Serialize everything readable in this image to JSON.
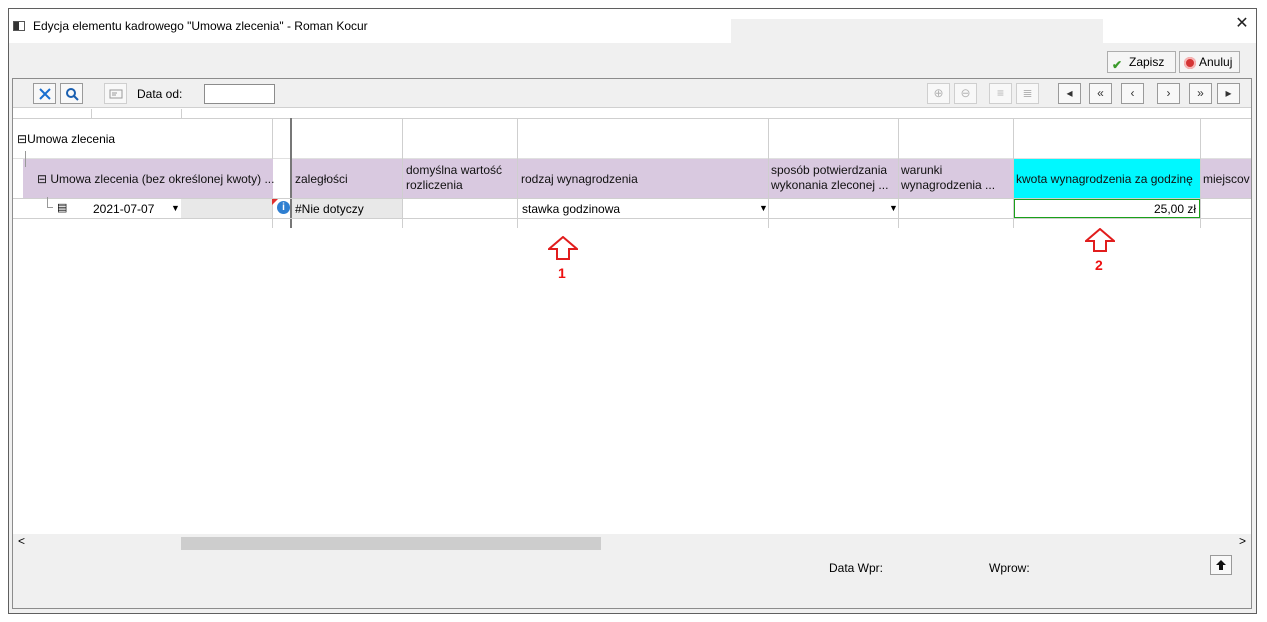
{
  "window": {
    "title": "Edycja elementu kadrowego \"Umowa zlecenia\" - Roman Kocur",
    "close_glyph": "✕"
  },
  "actions": {
    "save_label": "Zapisz",
    "cancel_label": "Anuluj"
  },
  "toolbar": {
    "date_from_label": "Data od:",
    "date_from_value": "",
    "nav": [
      "◂",
      "«",
      "‹",
      "›",
      "»",
      "▸"
    ]
  },
  "grid": {
    "group_row": "Umowa zlecenia",
    "subgroup_row": "Umowa zlecenia (bez określonej kwoty) ...",
    "columns": {
      "zaleglosci": "zaległości",
      "domyslna_1": "domyślna wartość",
      "domyslna_2": "rozliczenia",
      "rodzaj": "rodzaj wynagrodzenia",
      "sposob_1": "sposób potwierdzania",
      "sposob_2": "wykonania zleconej ...",
      "warunki_1": "warunki",
      "warunki_2": "wynagrodzenia ...",
      "kwota": "kwota wynagrodzenia za godzinę",
      "miejsce": "miejscov"
    },
    "row": {
      "date": "2021-07-07",
      "zaleglosci": "#Nie dotyczy",
      "rodzaj": "stawka godzinowa",
      "kwota": "25,00 zł"
    }
  },
  "annotations": {
    "marker_1": "1",
    "marker_2": "2",
    "color": "#e11d1d"
  },
  "footer": {
    "data_wpr_label": "Data Wpr:",
    "wprow_label": "Wprow:"
  },
  "scroll": {
    "left_glyph": "<",
    "right_glyph": ">"
  },
  "icons": {
    "settings": "tools-icon",
    "search": "search-icon",
    "card": "card-icon",
    "info": "info-icon",
    "up": "arrow-up-icon"
  }
}
